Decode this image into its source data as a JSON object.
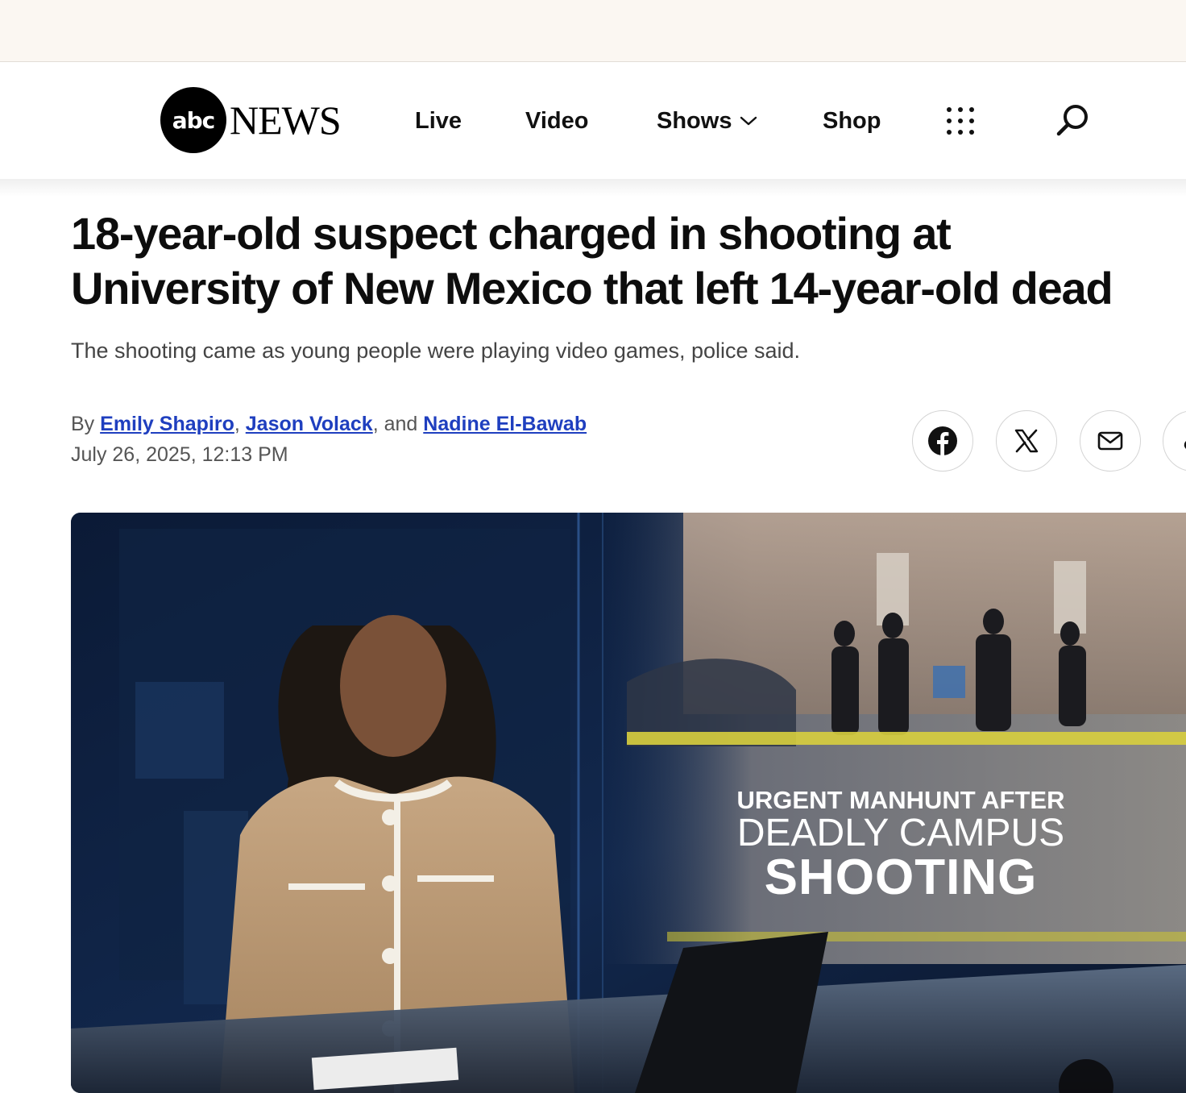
{
  "brand": {
    "logo_mark": "abc",
    "logo_word": "NEWS"
  },
  "nav": {
    "items": [
      {
        "label": "Live"
      },
      {
        "label": "Video"
      },
      {
        "label": "Shows"
      },
      {
        "label": "Shop"
      }
    ],
    "icons": [
      "grid-icon",
      "search-icon",
      "chevron-down-icon"
    ]
  },
  "article": {
    "headline_line1": "18-year-old suspect charged in shooting at",
    "headline_line2": "University of New Mexico that left 14-year-old dead",
    "subheadline": "The shooting came as young people were playing video games, police said.",
    "byline_prefix": "By",
    "authors": [
      "Emily Shapiro",
      "Jason Volack",
      "Nadine El-Bawab"
    ],
    "sep1": ",",
    "sep2": ", and",
    "date": "July 26, 2025, 12:13 PM"
  },
  "share": [
    "facebook-icon",
    "x-icon",
    "mail-icon",
    "link-icon"
  ],
  "video": {
    "chyron_line1": "URGENT MANHUNT AFTER",
    "chyron_line2": "DEADLY CAMPUS",
    "chyron_line3": "SHOOTING"
  },
  "colors": {
    "link": "#1f3fbf",
    "topbar": "#fbf7f2"
  }
}
